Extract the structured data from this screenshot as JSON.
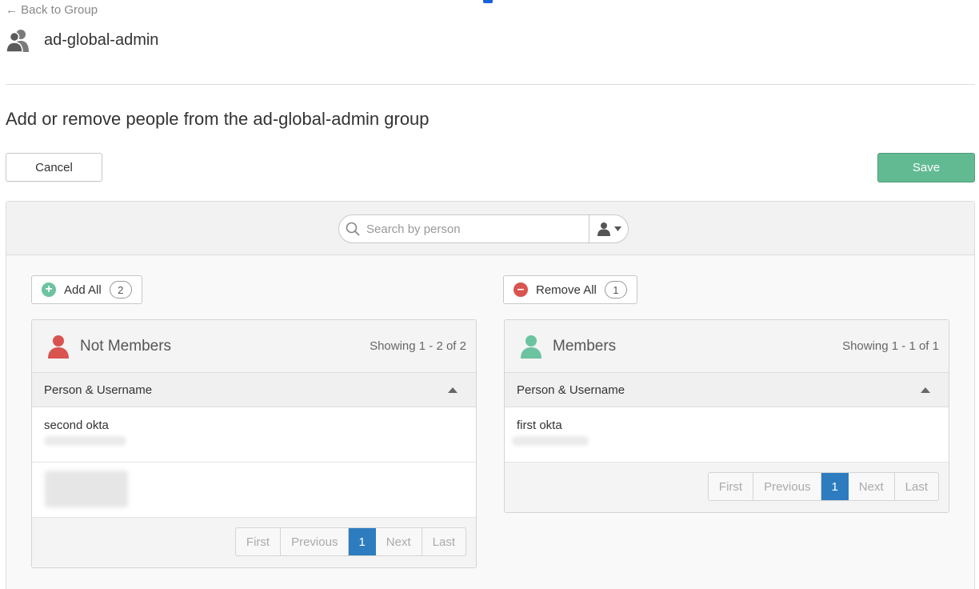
{
  "nav": {
    "back_label": "← Back to Group"
  },
  "group": {
    "name": "ad-global-admin",
    "icon": "group-icon"
  },
  "page": {
    "title": "Add or remove people from the ad-global-admin group"
  },
  "actions": {
    "cancel_label": "Cancel",
    "save_label": "Save"
  },
  "colors": {
    "save": "#62ba93",
    "not_members_icon": "#d9534f",
    "members_icon": "#6cc3a0",
    "page_active": "#2d7cc0"
  },
  "search": {
    "placeholder": "Search by person",
    "value": ""
  },
  "not_members": {
    "bulk_label": "Add All",
    "bulk_count": "2",
    "title": "Not Members",
    "showing": "Showing 1 - 2 of 2",
    "column": "Person & Username",
    "rows": [
      {
        "name": "second okta"
      },
      {
        "name": ""
      }
    ],
    "pager": {
      "first": "First",
      "previous": "Previous",
      "page": "1",
      "next": "Next",
      "last": "Last"
    }
  },
  "members": {
    "bulk_label": "Remove All",
    "bulk_count": "1",
    "title": "Members",
    "showing": "Showing 1 - 1 of 1",
    "column": "Person & Username",
    "rows": [
      {
        "name": "first okta"
      }
    ],
    "pager": {
      "first": "First",
      "previous": "Previous",
      "page": "1",
      "next": "Next",
      "last": "Last"
    }
  }
}
